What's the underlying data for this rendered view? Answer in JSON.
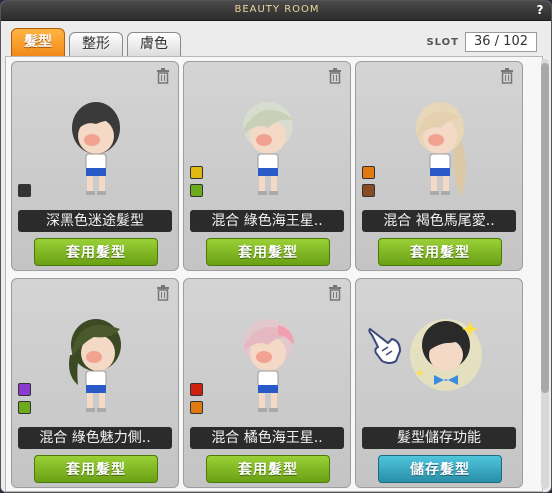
{
  "window": {
    "title": "BEAUTY ROOM",
    "help": "?"
  },
  "tabs": [
    {
      "label": "髮型",
      "active": true
    },
    {
      "label": "整形",
      "active": false
    },
    {
      "label": "膚色",
      "active": false
    }
  ],
  "slot": {
    "label": "SLOT",
    "value": "36 / 102"
  },
  "colors": {
    "active_tab": "#f08a18",
    "apply_button": "#7fb822",
    "save_button": "#2fa5bf",
    "name_bar": "#2b2b2b"
  },
  "cards": [
    {
      "name": "深黑色迷途髮型",
      "button": "套用髮型",
      "hair_color": "#3a3a3a",
      "swatches": [
        "#333333"
      ]
    },
    {
      "name": "混合 綠色海王星..",
      "button": "套用髮型",
      "hair_color": "#d8ddd0",
      "swatches": [
        "#e0b810",
        "#6bab1c"
      ]
    },
    {
      "name": "混合 褐色馬尾愛..",
      "button": "套用髮型",
      "hair_color": "#e8d6b8",
      "swatches": [
        "#e07a10",
        "#8a4a24"
      ]
    },
    {
      "name": "混合 綠色魅力側..",
      "button": "套用髮型",
      "hair_color": "#3c4a24",
      "swatches": [
        "#8a3ad0",
        "#6bab1c"
      ]
    },
    {
      "name": "混合 橘色海王星..",
      "button": "套用髮型",
      "hair_color": "#e0c8cc",
      "swatches": [
        "#d02010",
        "#e07a10"
      ]
    },
    {
      "name": "髮型儲存功能",
      "button": "儲存髮型"
    }
  ],
  "icons": {
    "delete": "trash-icon",
    "pointer": "pointing-hand-icon"
  }
}
